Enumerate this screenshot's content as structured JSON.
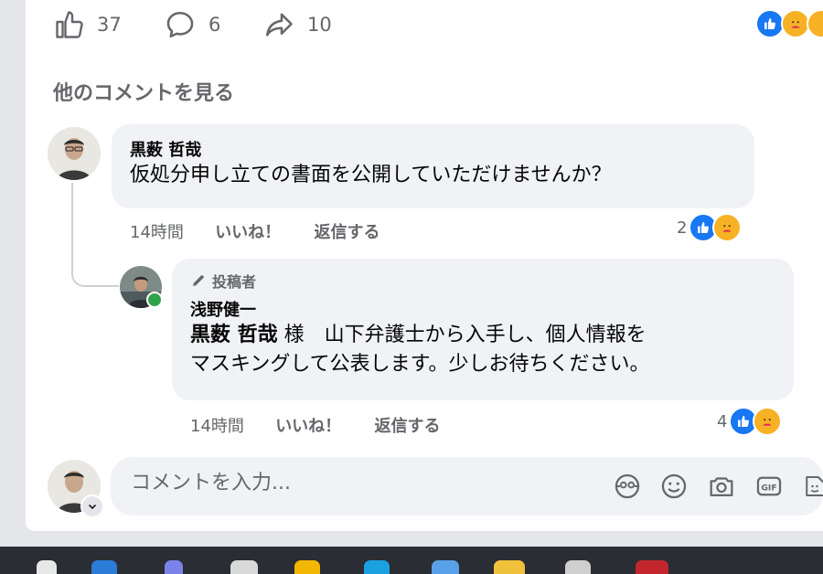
{
  "post_actions": {
    "like_count": "37",
    "comment_count": "6",
    "share_count": "10"
  },
  "more_comments_label": "他のコメントを見る",
  "comments": [
    {
      "author": "黒薮 哲哉",
      "text": "仮処分申し立ての書面を公開していただけませんか？",
      "time": "14時間",
      "like_label": "いいね！",
      "reply_label": "返信する",
      "reaction_count": "2"
    }
  ],
  "reply": {
    "badge": "投稿者",
    "author": "浅野健一",
    "mention": "黒薮 哲哉",
    "text_line1": " 様　山下弁護士から入手し、個人情報を",
    "text_line2": "マスキングして公表します。少しお待ちください。",
    "time": "14時間",
    "like_label": "いいね！",
    "reply_label": "返信する",
    "reaction_count": "4"
  },
  "composer": {
    "placeholder": "コメントを入力..."
  },
  "colors": {
    "brand": "#1877f2",
    "muted": "#65676b",
    "bubble": "#f0f2f5",
    "online": "#31a24c"
  }
}
